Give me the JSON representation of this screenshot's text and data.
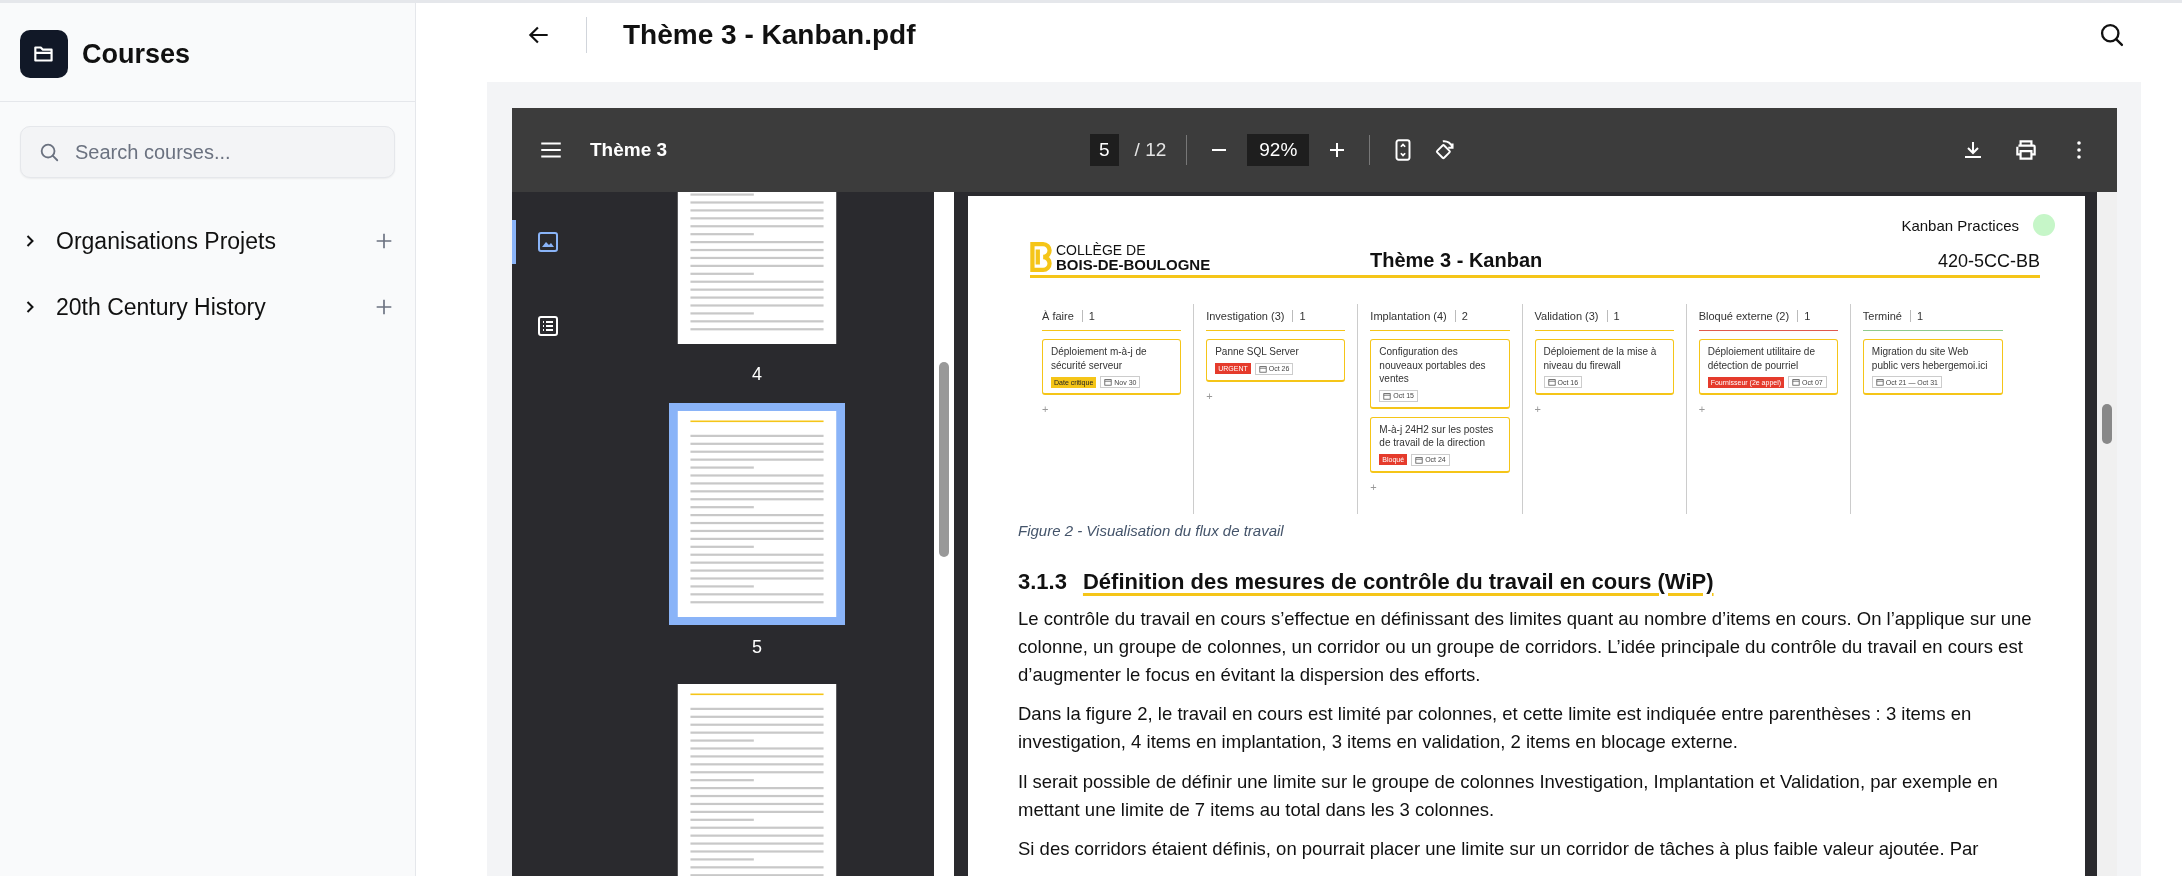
{
  "sidebar": {
    "title": "Courses",
    "search": {
      "placeholder": "Search courses..."
    },
    "items": [
      {
        "label": "Organisations Projets",
        "expanded": false
      },
      {
        "label": "20th Century History",
        "expanded": false
      }
    ]
  },
  "header": {
    "title": "Thème 3 - Kanban.pdf"
  },
  "viewer": {
    "title": "Thème 3",
    "page": "5",
    "pages": "/ 12",
    "zoom": "92%",
    "side_tabs": [
      {
        "kind": "thumbnails",
        "selected": true
      },
      {
        "kind": "outline",
        "selected": false
      }
    ],
    "thumbnails": [
      {
        "label": "4",
        "selected": false
      },
      {
        "label": "5",
        "selected": true
      },
      {
        "selected": false
      }
    ]
  },
  "document": {
    "badge": "Kanban Practices",
    "logo_top": "COLLÈGE DE",
    "logo_bottom": "BOIS-DE-BOULOGNE",
    "title": "Thème 3 - Kanban",
    "code": "420-5CC-BB",
    "board": {
      "columns": [
        {
          "title": "À faire",
          "count": "1",
          "color": "#f5c518",
          "add": "+",
          "cards": [
            {
              "text": "Déploiement m-à-j de sécurité serveur",
              "tag": {
                "label": "Date critique",
                "color": "#f5c518"
              },
              "date": "Nov 30"
            }
          ]
        },
        {
          "title": "Investigation (3)",
          "count": "1",
          "color": "#f5c518",
          "add": "+",
          "cards": [
            {
              "text": "Panne SQL Server",
              "tag": {
                "label": "URGENT",
                "color": "#e53b2c"
              },
              "date": "Oct 26"
            }
          ]
        },
        {
          "title": "Implantation (4)",
          "count": "2",
          "color": "#f5c518",
          "add": "+",
          "cards": [
            {
              "text": "Configuration des nouveaux portables des ventes",
              "date": "Oct 15"
            },
            {
              "text": "M-à-j 24H2 sur les postes de travail de la direction",
              "tag": {
                "label": "Bloqué",
                "color": "#e53b2c"
              },
              "date": "Oct 24"
            }
          ]
        },
        {
          "title": "Validation (3)",
          "count": "1",
          "color": "#f5c518",
          "add": "+",
          "cards": [
            {
              "text": "Déploiement de la mise à niveau du firewall",
              "date": "Oct 16"
            }
          ]
        },
        {
          "title": "Bloqué externe (2)",
          "count": "1",
          "color": "#e05a4f",
          "add": "+",
          "cards": [
            {
              "text": "Déploiement utilitaire de détection de pourriel",
              "tag": {
                "label": "Fournisseur (2e appel)",
                "color": "#e53b2c"
              },
              "date": "Oct 07"
            }
          ]
        },
        {
          "title": "Terminé",
          "count": "1",
          "color": "#8fcb8f",
          "cards": [
            {
              "text": "Migration du site Web public vers hebergemoi.ici",
              "date": "Oct 21 — Oct 31"
            }
          ]
        }
      ]
    },
    "caption": "Figure 2 - Visualisation du flux de travail",
    "section_number": "3.1.3",
    "section_title": "Définition des mesures de contrôle du travail en cours (WiP)",
    "paragraphs": [
      "Le contrôle du travail en cours s’effectue en définissant des limites quant au nombre d’items en cours. On l’applique sur une colonne, un groupe de colonnes, un corridor ou un groupe de corridors. L’idée principale du contrôle du travail en cours est d’augmenter le focus en évitant la dispersion des efforts.",
      "Dans la figure 2, le travail en cours est limité par colonnes, et cette limite est indiquée entre parenthèses : 3 items en investigation, 4 items en implantation, 3 items en validation, 2 items en blocage externe.",
      "Il serait possible de définir une limite sur le groupe de colonnes Investigation, Implantation et Validation, par exemple en mettant une limite de 7 items au total dans les 3 colonnes.",
      "Si des corridors étaient définis, on pourrait placer une limite sur un corridor de tâches à plus faible valeur ajoutée. Par"
    ]
  }
}
